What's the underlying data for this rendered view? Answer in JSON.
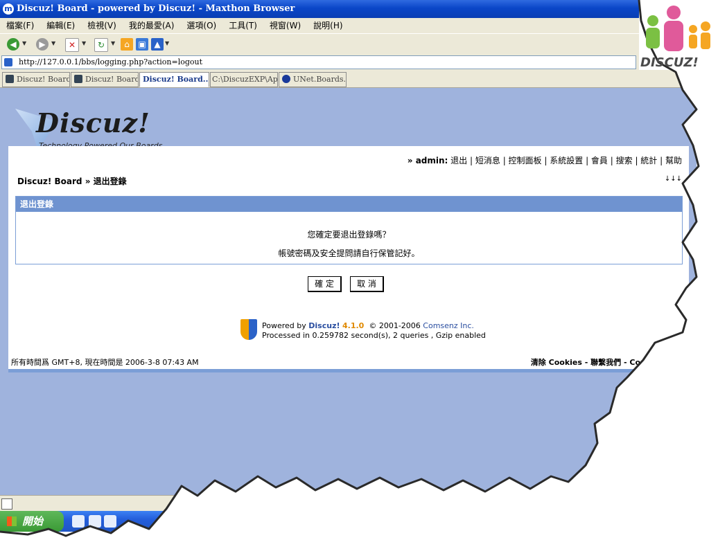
{
  "window": {
    "title": "Discuz! Board - powered by Discuz! - Maxthon Browser"
  },
  "menu": [
    "檔案(F)",
    "編輯(E)",
    "檢視(V)",
    "我的最愛(A)",
    "選項(O)",
    "工具(T)",
    "視窗(W)",
    "說明(H)"
  ],
  "address": {
    "url": "http://127.0.0.1/bbs/logging.php?action=logout"
  },
  "tabs": [
    {
      "label": "Discuz! Board..."
    },
    {
      "label": "Discuz! Board..."
    },
    {
      "label": "Discuz! Board..."
    },
    {
      "label": "C:\\DiscuzEXP\\Ap..."
    },
    {
      "label": "UNet.Boards...."
    }
  ],
  "logo": {
    "name": "Discuz!",
    "tagline": "Technology Powered Our Boards"
  },
  "userbar": {
    "prefix": "» admin:",
    "links": [
      "退出",
      "短消息",
      "控制面板",
      "系統設置",
      "會員",
      "搜索",
      "統計",
      "幫助"
    ]
  },
  "breadcrumb": {
    "home": "Discuz! Board",
    "sep": " » ",
    "current": "退出登錄"
  },
  "nav_arrows": "↓↓↓",
  "logout": {
    "title": "退出登錄",
    "question": "您確定要退出登錄嗎？",
    "note": "帳號密碼及安全提問請自行保管記好。",
    "confirm_label": "確 定",
    "cancel_label": "取 消"
  },
  "footer": {
    "powered_prefix": "Powered by",
    "brand": "Discuz!",
    "version": "4.1.0",
    "copyright": "© 2001-2006",
    "company": "Comsenz Inc.",
    "processed": "Processed in 0.259782 second(s), 2 queries , Gzip enabled",
    "timezone": "所有時間爲 GMT+8, 現在時間是 2006-3-8 07:43 AM",
    "links": {
      "clear": "清除 Cookies",
      "sep1": " - ",
      "contact": "聯繫我們",
      "sep2": " - ",
      "company": "Comsenz Inc"
    }
  },
  "taskbar": {
    "start_label": "開始"
  },
  "corner_logo": {
    "text": "DISCUZ!"
  }
}
